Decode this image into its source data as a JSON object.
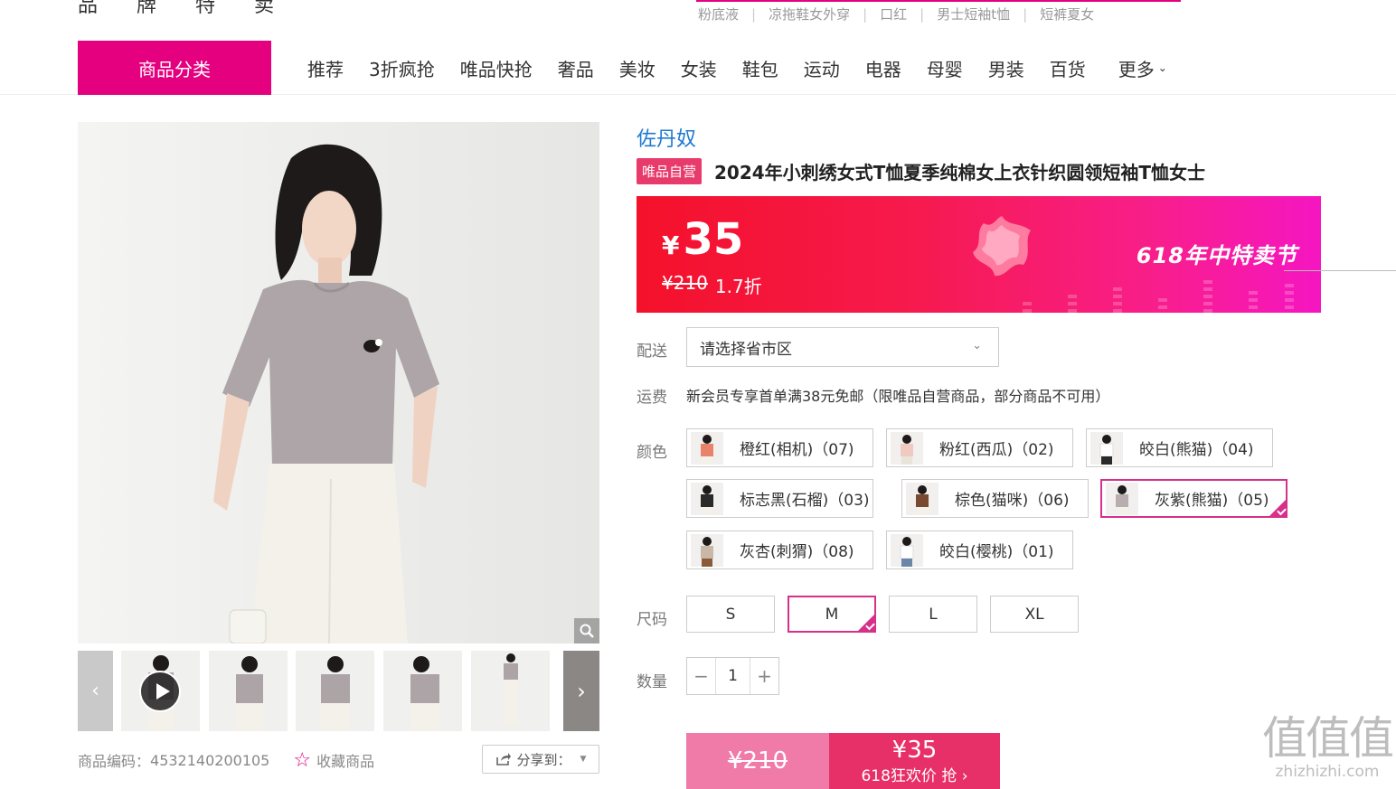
{
  "header": {
    "logo": "品 牌 特 卖",
    "hot_searches": [
      "粉底液",
      "凉拖鞋女外穿",
      "口红",
      "男士短袖t恤",
      "短裤夏女"
    ]
  },
  "nav": {
    "category_button": "商品分类",
    "items": [
      "推荐",
      "3折疯抢",
      "唯品快抢",
      "奢品",
      "美妆",
      "女装",
      "鞋包",
      "运动",
      "电器",
      "母婴",
      "男装",
      "百货"
    ],
    "more": "更多"
  },
  "gallery": {
    "product_code_label": "商品编码：",
    "product_code": "4532140200105",
    "favorite": "收藏商品",
    "share": "分享到："
  },
  "product": {
    "brand": "佐丹奴",
    "self_tag": "唯品自营",
    "title": "2024年小刺绣女式T恤夏季纯棉女上衣针织圆领短袖T恤女士"
  },
  "price": {
    "currency": "¥",
    "current": "35",
    "original": "¥210",
    "discount": "1.7折",
    "event": "618年中特卖节"
  },
  "delivery": {
    "label": "配送",
    "placeholder": "请选择省市区"
  },
  "shipping": {
    "label": "运费",
    "text": "新会员专享首单满38元免邮（限唯品自营商品，部分商品不可用）"
  },
  "colors": {
    "label": "颜色",
    "options": [
      {
        "name": "橙红(相机)（07)",
        "tint": "#e8826a"
      },
      {
        "name": "粉红(西瓜)（02)",
        "tint": "#f0c9c0"
      },
      {
        "name": "皎白(熊猫)（04)",
        "tint": "#f4f2ee"
      },
      {
        "name": "标志黑(石榴)（03)",
        "tint": "#2a2a2a"
      },
      {
        "name": "棕色(猫咪)（06)",
        "tint": "#7a4a30"
      },
      {
        "name": "灰紫(熊猫)（05)",
        "tint": "#b8aeb0"
      },
      {
        "name": "灰杏(刺猬)（08)",
        "tint": "#c9b8a8"
      },
      {
        "name": "皎白(樱桃)（01)",
        "tint": "#f4f2ee"
      }
    ],
    "selected_index": 5
  },
  "sizes": {
    "label": "尺码",
    "options": [
      "S",
      "M",
      "L",
      "XL"
    ],
    "selected_index": 1
  },
  "quantity": {
    "label": "数量",
    "value": "1",
    "minus": "−",
    "plus": "+"
  },
  "buy": {
    "original": "¥210",
    "price": "¥35",
    "action": "618狂欢价 抢 ›"
  },
  "watermark": {
    "big": "值值值",
    "small": "zhizhizhi.com"
  },
  "accent": "#e4007f"
}
